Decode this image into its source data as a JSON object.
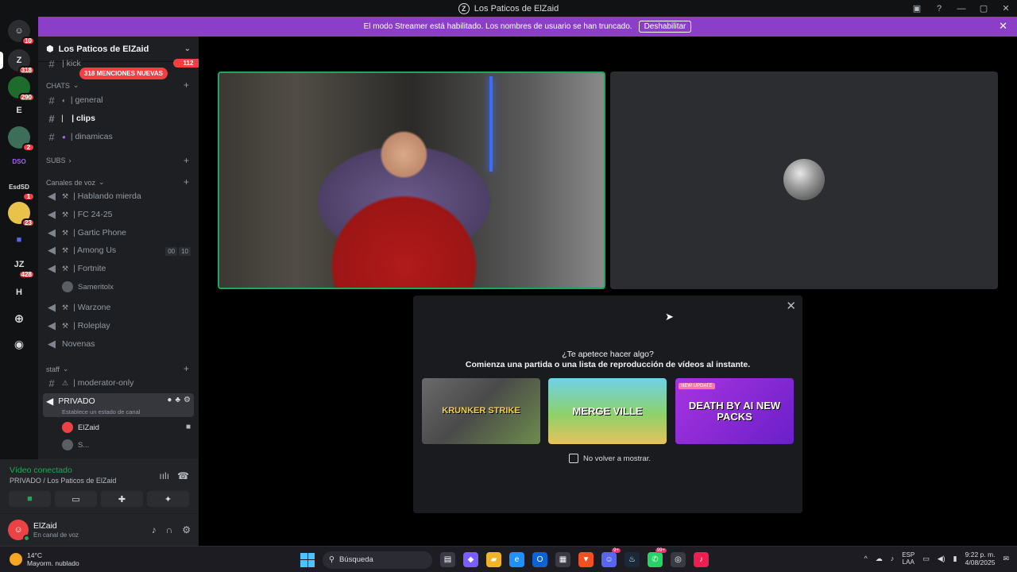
{
  "window": {
    "title": "Los Paticos de ElZaid",
    "logo_glyph": "Z"
  },
  "banner": {
    "message": "El modo Streamer está habilitado. Los nombres de usuario se han truncado.",
    "button": "Deshabilitar"
  },
  "rail": {
    "servers": [
      {
        "label": "",
        "badge": "10",
        "color": "#2b2d31"
      },
      {
        "label": "Z",
        "badge": "318",
        "color": "#2b2d31"
      },
      {
        "label": "",
        "badge": "290",
        "color": "#1f6b2e"
      },
      {
        "label": "E",
        "badge": "",
        "color": "#111214"
      },
      {
        "label": "",
        "badge": "2",
        "color": "#3c6e5a"
      },
      {
        "label": "DSO",
        "badge": "",
        "color": "#111214"
      },
      {
        "label": "EsdSD",
        "badge": "1",
        "color": "#111214"
      },
      {
        "label": "",
        "badge": "23",
        "color": "#e8c24a"
      },
      {
        "label": "",
        "badge": "",
        "color": "#111214"
      },
      {
        "label": "JZ",
        "badge": "428",
        "color": "#111214"
      },
      {
        "label": "H",
        "badge": "",
        "color": "#111214"
      }
    ]
  },
  "sidebar": {
    "guild_name": "Los Paticos de ElZaid",
    "truncated_top": "| kick",
    "truncated_badge": "112",
    "mentions_pill": "318 MENCIONES NUEVAS",
    "categories": {
      "chats": "CHATS",
      "subs": "SUBS",
      "voice": "Canales de voz",
      "staff": "staff"
    },
    "text_channels": [
      {
        "name": "| general"
      },
      {
        "name": "| clips"
      },
      {
        "name": "| dinamicas"
      }
    ],
    "voice_channels": [
      {
        "name": "| Hablando mierda"
      },
      {
        "name": "| FC 24-25"
      },
      {
        "name": "| Gartic Phone"
      },
      {
        "name": "| Among Us",
        "extra": [
          "00",
          "10"
        ]
      },
      {
        "name": "| Fortnite"
      },
      {
        "name": "| Warzone"
      },
      {
        "name": "| Roleplay"
      },
      {
        "name": "Novenas"
      }
    ],
    "fortnite_user": "Sameritolx",
    "staff_channel": "| moderator-only",
    "privado": {
      "name": "PRIVADO",
      "status_hint": "Establece un estado de canal"
    },
    "privado_users": [
      "ElZaid",
      "S..."
    ]
  },
  "voice_panel": {
    "status": "Vídeo conectado",
    "location": "PRIVADO / Los Paticos de ElZaid"
  },
  "user": {
    "name": "ElZaid",
    "status": "En canal de voz"
  },
  "popup": {
    "question": "¿Te apetece hacer algo?",
    "subtitle": "Comienza una partida o una lista de reproducción de vídeos al instante.",
    "games": [
      {
        "title": "KRUNKER STRIKE",
        "tag": ""
      },
      {
        "title": "MERGE VILLE",
        "tag": ""
      },
      {
        "title": "DEATH BY AI NEW PACKS",
        "tag": "NEW UPDATE"
      }
    ],
    "checkbox": "No volver a mostrar."
  },
  "taskbar": {
    "temperature": "14°C",
    "weather": "Mayorm. nublado",
    "search_placeholder": "Búsqueda",
    "steam_badge": "9+",
    "whatsapp_badge": "99+",
    "lang_top": "ESP",
    "lang_bottom": "LAA",
    "time": "9:22 p. m.",
    "date": "4/08/2025"
  }
}
